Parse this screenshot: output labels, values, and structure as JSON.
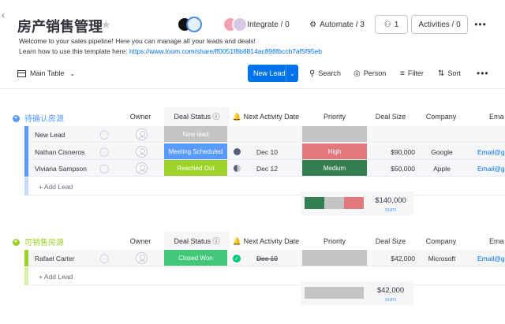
{
  "board": {
    "title": "房产销售管理",
    "description_line1": "Welcome to your sales pipeline! Here you can manage all your leads and deals!",
    "description_line2_prefix": "Learn how to use this template here: ",
    "description_link": "https://www.loom.com/share/ff0051f8b8814ac898fbccb7af5f95eb"
  },
  "header": {
    "integrate": "Integrate / 0",
    "automate": "Automate / 3",
    "people_count": "1",
    "activities": "Activities / 0"
  },
  "toolbar": {
    "main_table": "Main Table",
    "new_item": "New Lead",
    "search": "Search",
    "person": "Person",
    "filter": "Filter",
    "sort": "Sort"
  },
  "columns": {
    "owner": "Owner",
    "deal_status": "Deal Status",
    "next_activity": "Next Activity Date",
    "priority": "Priority",
    "deal_size": "Deal Size",
    "company": "Company",
    "email": "Ema"
  },
  "groups": [
    {
      "title": "待确认房源",
      "color": "#579bfc",
      "add_label": "+ Add Lead",
      "rows": [
        {
          "name": "New Lead",
          "status": "New lead",
          "status_color": "#c4c4c4",
          "date": "",
          "date_icon": "",
          "priority": "",
          "priority_color": "#c4c4c4",
          "deal_size": "",
          "company": "",
          "email": ""
        },
        {
          "name": "Nathan Cisneros",
          "status": "Meeting Scheduled",
          "status_color": "#579bfc",
          "date": "Dec 10",
          "date_icon": "moon",
          "priority": "High",
          "priority_color": "#e2787b",
          "deal_size": "$90,000",
          "company": "Google",
          "email": "Email@gm"
        },
        {
          "name": "Viviana Sampson",
          "status": "Reached Out",
          "status_color": "#9cd326",
          "date": "Dec 12",
          "date_icon": "half",
          "priority": "Medium",
          "priority_color": "#347d4e",
          "deal_size": "$50,000",
          "company": "Apple",
          "email": "Email@gm"
        }
      ],
      "summary": {
        "value": "$140,000",
        "label": "sum",
        "priority_mix": [
          "#347d4e",
          "#c4c4c4",
          "#e2787b"
        ]
      }
    },
    {
      "title": "可销售房源",
      "color": "#9cd326",
      "add_label": "+ Add Lead",
      "rows": [
        {
          "name": "Rafael Carter",
          "status": "Closed Won",
          "status_color": "#40c878",
          "date": "Dec 10",
          "date_icon": "check",
          "priority": "",
          "priority_color": "#c4c4c4",
          "deal_size": "$42,000",
          "company": "Microsoft",
          "email": "Email@gm"
        }
      ],
      "summary": {
        "value": "$42,000",
        "label": "sum",
        "priority_mix": [
          "#c4c4c4"
        ]
      }
    }
  ]
}
